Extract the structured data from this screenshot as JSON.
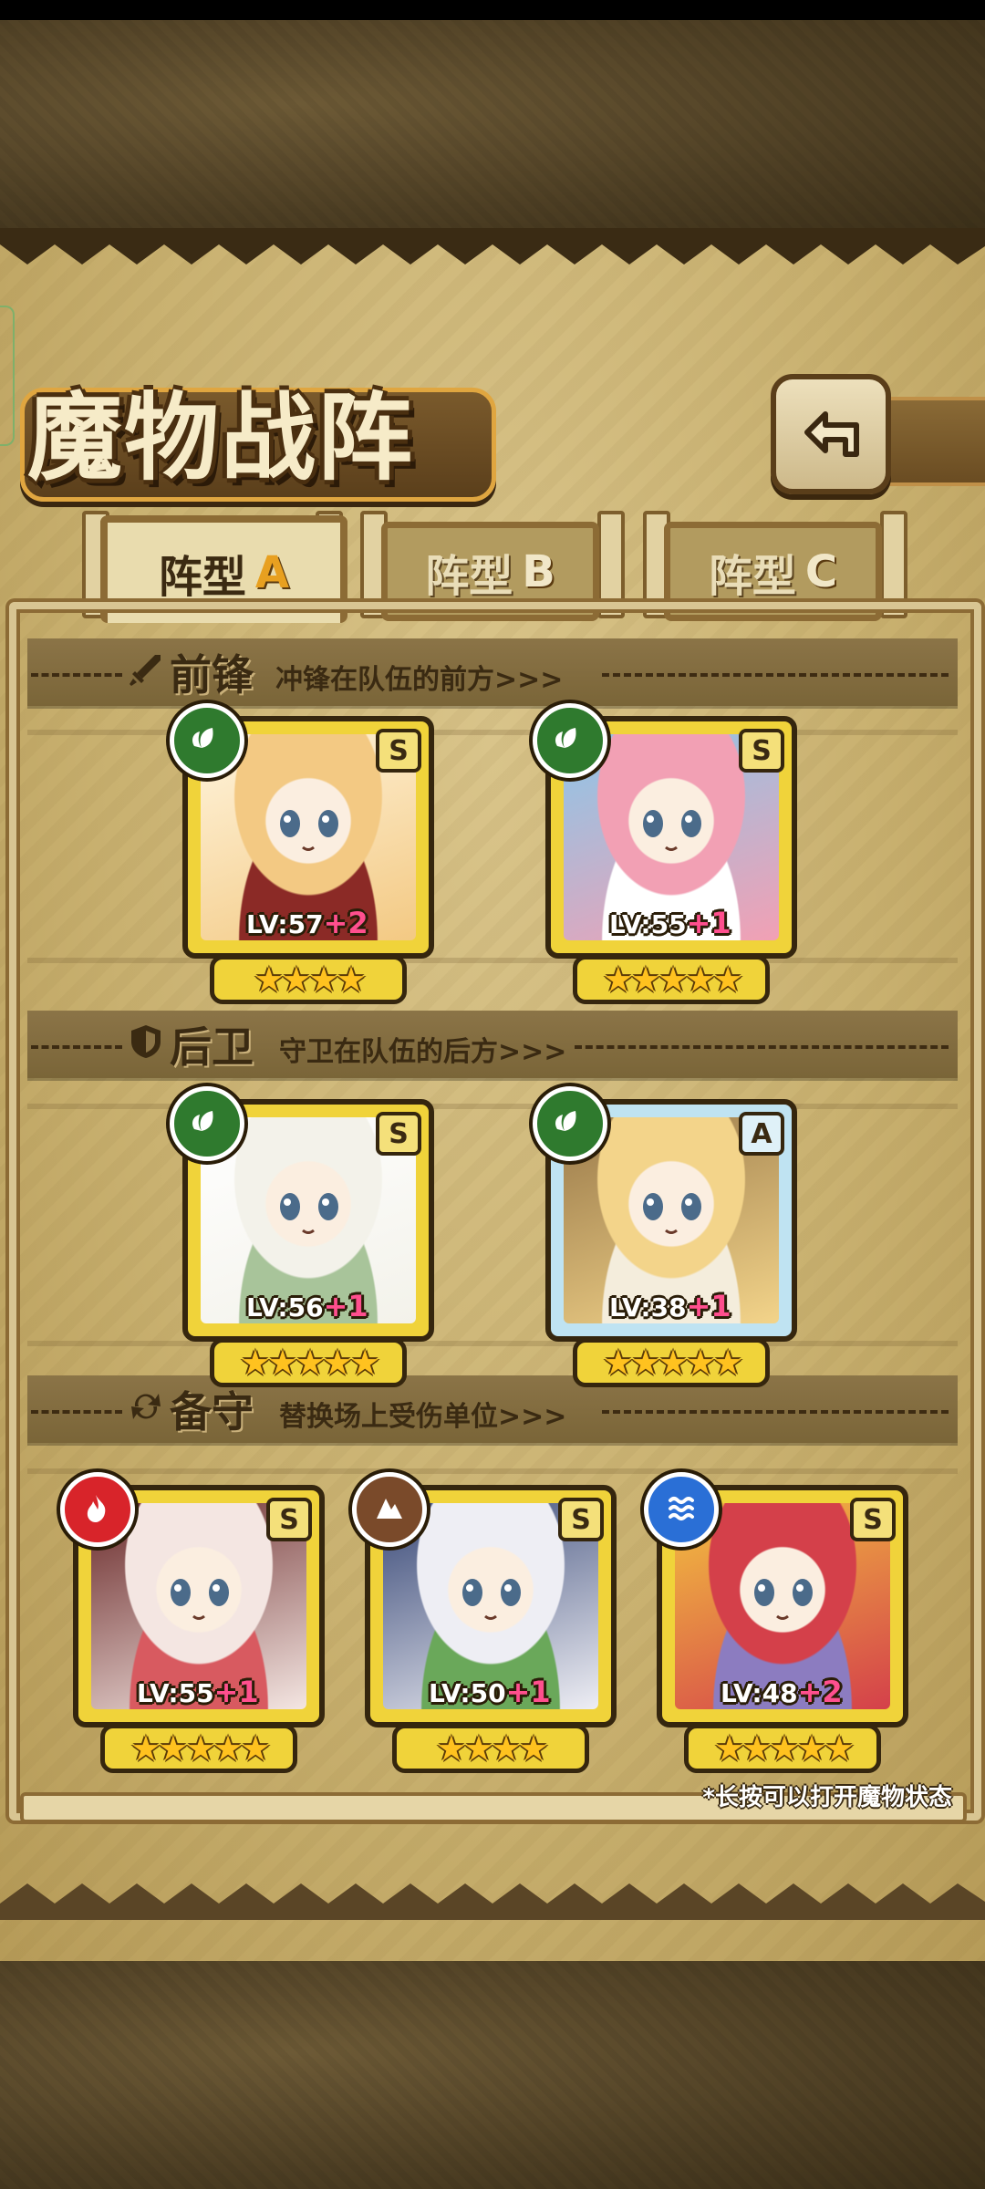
{
  "page": {
    "title": "魔物战阵",
    "back_icon": "back-arrow-icon",
    "hint": "*长按可以打开魔物状态"
  },
  "tabs": [
    {
      "label": "阵型",
      "letter": "A",
      "active": true
    },
    {
      "label": "阵型",
      "letter": "B",
      "active": false
    },
    {
      "label": "阵型",
      "letter": "C",
      "active": false
    }
  ],
  "sections": {
    "vanguard": {
      "title": "前锋",
      "subtitle": "冲锋在队伍的前方>>>",
      "icon": "sword-icon"
    },
    "rearguard": {
      "title": "后卫",
      "subtitle": "守卫在队伍的后方>>>",
      "icon": "shield-icon"
    },
    "reserve": {
      "title": "备守",
      "subtitle": "替换场上受伤单位>>>",
      "icon": "swap-icon"
    }
  },
  "monsters": {
    "vanguard": [
      {
        "level": "LV:57",
        "bonus": "+2",
        "stars": 4,
        "rank": "S",
        "element": "leaf-element-icon",
        "colors": [
          "#f3c983",
          "#8b2a26",
          "#fff4dc"
        ]
      },
      {
        "level": "LV:55",
        "bonus": "+1",
        "stars": 5,
        "rank": "S",
        "element": "leaf-element-icon",
        "colors": [
          "#f2a0b4",
          "#ffffff",
          "#8cc6e8"
        ]
      }
    ],
    "rearguard": [
      {
        "level": "LV:56",
        "bonus": "+1",
        "stars": 5,
        "rank": "S",
        "element": "leaf-element-icon",
        "colors": [
          "#f3f2ea",
          "#a8c49a",
          "#ffffff"
        ]
      },
      {
        "level": "LV:38",
        "bonus": "+1",
        "stars": 5,
        "rank": "A",
        "element": "leaf-element-icon",
        "colors": [
          "#f3d48a",
          "#f4eddc",
          "#9a7a4a"
        ]
      }
    ],
    "reserve": [
      {
        "level": "LV:55",
        "bonus": "+1",
        "stars": 5,
        "rank": "S",
        "element": "fire-element-icon",
        "colors": [
          "#f4e6e2",
          "#d85a60",
          "#6a2a2a"
        ]
      },
      {
        "level": "LV:50",
        "bonus": "+1",
        "stars": 4,
        "rank": "S",
        "element": "earth-element-icon",
        "colors": [
          "#eeeef4",
          "#6aa85a",
          "#3a4a78"
        ]
      },
      {
        "level": "LV:48",
        "bonus": "+2",
        "stars": 5,
        "rank": "S",
        "element": "water-element-icon",
        "colors": [
          "#d4404a",
          "#8c7cc0",
          "#f3c040"
        ]
      }
    ]
  },
  "element_colors": {
    "leaf-element-icon": "#2f7a2e",
    "fire-element-icon": "#d8242a",
    "earth-element-icon": "#7a4a2a",
    "water-element-icon": "#2a6fd6"
  },
  "star_glyph": "★"
}
